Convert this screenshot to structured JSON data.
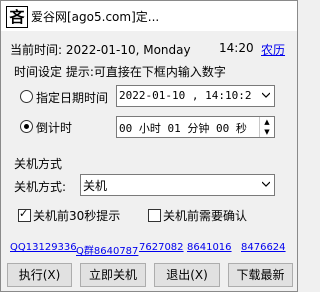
{
  "window": {
    "title": "爱谷网[ago5.com]定...",
    "icon_glyph": "吝"
  },
  "header": {
    "now_label": "当前时间: 2022-01-10, Monday",
    "clock": "14:20",
    "lunar_link": "农历"
  },
  "time_setting": {
    "label": "时间设定 提示:可直接在下框内输入数字",
    "date_option": {
      "label": "指定日期时间",
      "selected": false,
      "value": "2022-01-10 , 14:10:2"
    },
    "countdown_option": {
      "label": "倒计时",
      "selected": true,
      "value": "00 小时 01 分钟 00 秒"
    }
  },
  "shutdown": {
    "section_label": "关机方式",
    "mode_label": "关机方式:",
    "mode_value": "关机",
    "remind_30s": {
      "label": "关机前30秒提示",
      "checked": true
    },
    "need_confirm": {
      "label": "关机前需要确认",
      "checked": false
    }
  },
  "qq_links": [
    "QQ13129336",
    "Q群8640787",
    "7627082",
    "8641016",
    "8476624"
  ],
  "buttons": {
    "execute": "执行(X)",
    "shutdown_now": "立即关机",
    "exit": "退出(X)",
    "download": "下载最新"
  },
  "colors": {
    "link": "#0000ee"
  }
}
